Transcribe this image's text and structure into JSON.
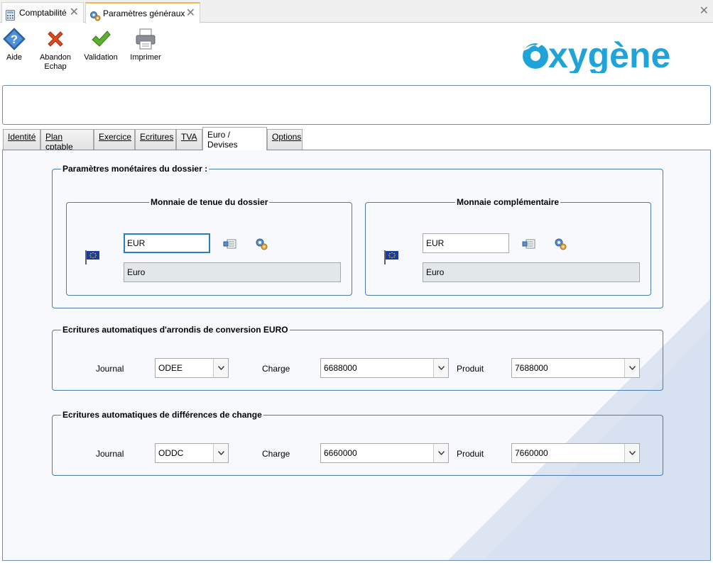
{
  "window_tabs": [
    {
      "label": "Comptabilité",
      "active": false
    },
    {
      "label": "Paramètres généraux",
      "active": true
    }
  ],
  "toolbar": {
    "help_label": "Aide",
    "cancel_label_line1": "Abandon",
    "cancel_label_line2": "Echap",
    "validate_label": "Validation",
    "print_label": "Imprimer"
  },
  "logo": {
    "text": "xygène",
    "color": "#1fa3d8"
  },
  "tabs": [
    {
      "label": "Identité"
    },
    {
      "label": "Plan cptable"
    },
    {
      "label": "Exercice"
    },
    {
      "label": "Ecritures"
    },
    {
      "label": "TVA"
    },
    {
      "label": "Euro / Devises",
      "active": true
    },
    {
      "label": "Options"
    }
  ],
  "monetary": {
    "legend": "Paramètres monétaires du dossier :",
    "main_currency": {
      "legend": "Monnaie de tenue du dossier",
      "code": "EUR",
      "name": "Euro",
      "flag_icon": "eu-flag-icon"
    },
    "secondary_currency": {
      "legend": "Monnaie complémentaire",
      "code": "EUR",
      "name": "Euro",
      "flag_icon": "eu-flag-icon"
    }
  },
  "rounding": {
    "legend": "Ecritures automatiques d'arrondis de conversion EURO",
    "journal_label": "Journal",
    "journal": "ODEE",
    "charge_label": "Charge",
    "charge": "6688000",
    "produit_label": "Produit",
    "produit": "7688000"
  },
  "exchange": {
    "legend": "Ecritures automatiques de différences de change",
    "journal_label": "Journal",
    "journal": "ODDC",
    "charge_label": "Charge",
    "charge": "6660000",
    "produit_label": "Produit",
    "produit": "7660000"
  },
  "colors": {
    "accent": "#2b7dc2",
    "border": "#4f7bab",
    "tab_highlight": "#f1b84c"
  }
}
